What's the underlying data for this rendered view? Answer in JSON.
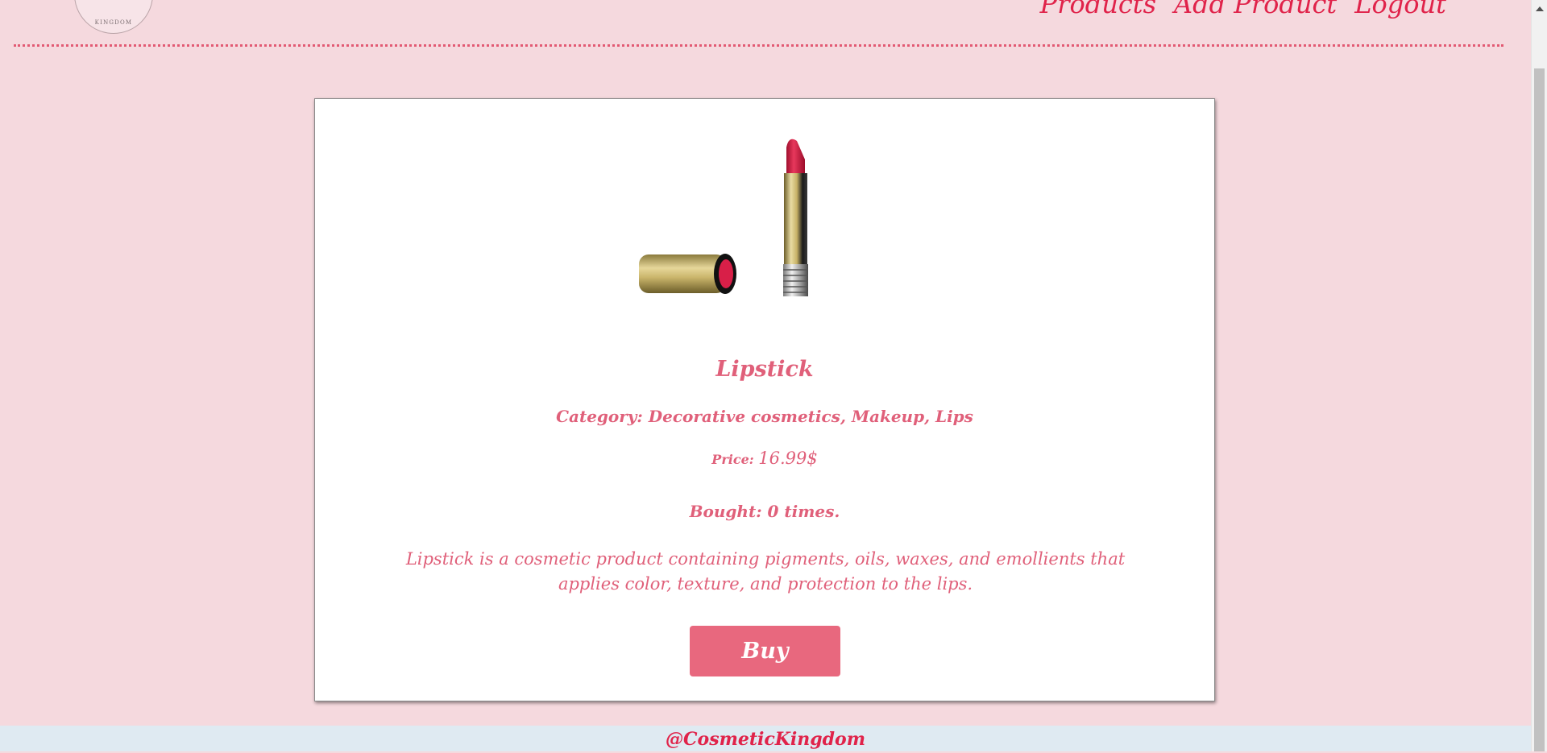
{
  "header": {
    "logo_text": "KINGDOM",
    "nav": [
      {
        "label": "Products"
      },
      {
        "label": "Add Product"
      },
      {
        "label": "Logout"
      }
    ]
  },
  "product": {
    "title": "Lipstick",
    "category_label": "Category:",
    "category_value": "Decorative cosmetics, Makeup, Lips",
    "price_label": "Price:",
    "price_value": "16.99$",
    "bought_text": "Bought: 0 times.",
    "description": "Lipstick is a cosmetic product containing pigments, oils, waxes, and emollients that applies color, texture, and protection to the lips.",
    "buy_label": "Buy"
  },
  "footer": {
    "text": "@CosmeticKingdom"
  },
  "colors": {
    "page_bg": "#f5d9de",
    "accent": "#e0234a",
    "text_pink": "#e0607a",
    "button": "#e8687e",
    "footer_bg": "#dfeaf2"
  }
}
